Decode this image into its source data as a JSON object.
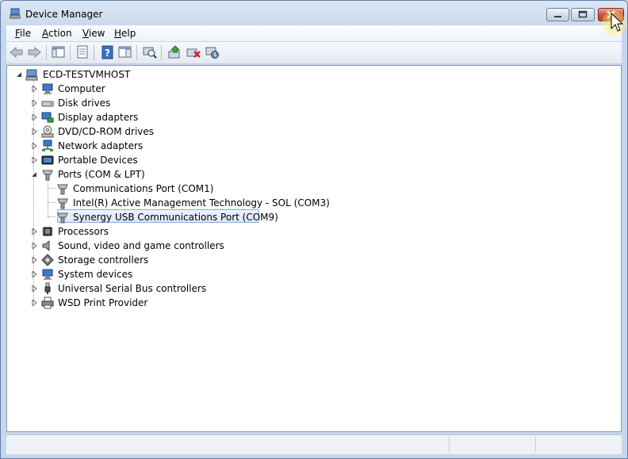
{
  "window": {
    "title": "Device Manager"
  },
  "icons": {
    "app": "device-manager-icon",
    "minimize": "minimize-icon",
    "maximize": "maximize-icon",
    "close": "close-icon"
  },
  "menu": [
    {
      "label": "File",
      "accel": "F"
    },
    {
      "label": "Action",
      "accel": "A"
    },
    {
      "label": "View",
      "accel": "V"
    },
    {
      "label": "Help",
      "accel": "H"
    }
  ],
  "toolbar": [
    "back",
    "forward",
    "show-hide-console-tree",
    "properties",
    "help",
    "action-pane",
    "scan-hardware",
    "update-driver",
    "uninstall",
    "disable"
  ],
  "tree": {
    "root": "ECD-TESTVMHOST",
    "nodes": [
      {
        "label": "Computer",
        "icon": "computer-icon",
        "expanded": false
      },
      {
        "label": "Disk drives",
        "icon": "disk-drive-icon",
        "expanded": false
      },
      {
        "label": "Display adapters",
        "icon": "display-adapter-icon",
        "expanded": false
      },
      {
        "label": "DVD/CD-ROM drives",
        "icon": "dvd-drive-icon",
        "expanded": false
      },
      {
        "label": "Network adapters",
        "icon": "network-adapter-icon",
        "expanded": false
      },
      {
        "label": "Portable Devices",
        "icon": "portable-device-icon",
        "expanded": false
      },
      {
        "label": "Ports (COM & LPT)",
        "icon": "port-icon",
        "expanded": true,
        "children": [
          {
            "label": "Communications Port (COM1)",
            "icon": "port-icon"
          },
          {
            "label": "Intel(R) Active Management Technology - SOL (COM3)",
            "icon": "port-icon"
          },
          {
            "label": "Synergy USB Communications Port (COM9)",
            "icon": "port-icon",
            "selected": true
          }
        ]
      },
      {
        "label": "Processors",
        "icon": "processor-icon",
        "expanded": false
      },
      {
        "label": "Sound, video and game controllers",
        "icon": "speaker-icon",
        "expanded": false
      },
      {
        "label": "Storage controllers",
        "icon": "storage-controller-icon",
        "expanded": false
      },
      {
        "label": "System devices",
        "icon": "system-device-icon",
        "expanded": false
      },
      {
        "label": "Universal Serial Bus controllers",
        "icon": "usb-icon",
        "expanded": false
      },
      {
        "label": "WSD Print Provider",
        "icon": "printer-icon",
        "expanded": false
      }
    ]
  }
}
